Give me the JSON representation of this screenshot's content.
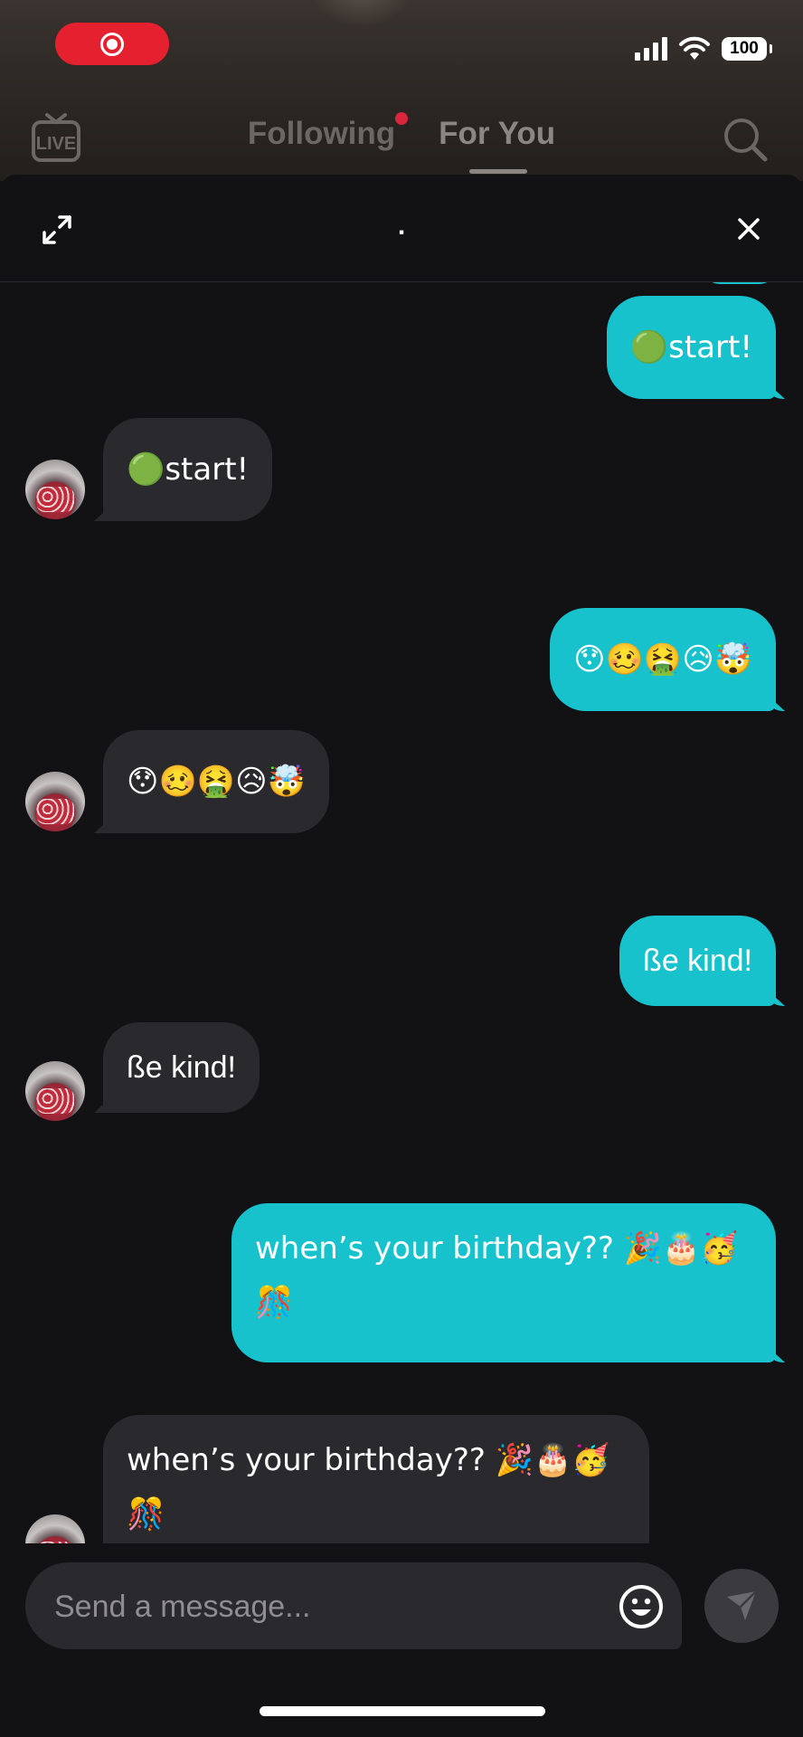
{
  "status_bar": {
    "battery": "100",
    "icons": [
      "screen-record-icon",
      "signal-icon",
      "wifi-icon",
      "battery-icon"
    ]
  },
  "nav": {
    "live_label": "LIVE",
    "tabs": [
      {
        "label": "Following",
        "has_notification": true
      },
      {
        "label": "For You",
        "active": true
      }
    ]
  },
  "chat": {
    "title": ".",
    "messages": [
      {
        "from": "me",
        "text": "🟢start!"
      },
      {
        "from": "them",
        "text": "🟢start!"
      },
      {
        "from": "me",
        "text": "😯🥴🤮😥🤯"
      },
      {
        "from": "them",
        "text": "😯🥴🤮😥🤯"
      },
      {
        "from": "me",
        "text": "ße kind!"
      },
      {
        "from": "them",
        "text": "ße kind!"
      },
      {
        "from": "me",
        "text": "when’s your birthday?? 🎉🎂🥳🎊"
      },
      {
        "from": "them",
        "text": "when’s your birthday?? 🎉🎂🥳🎊"
      }
    ]
  },
  "composer": {
    "placeholder": "Send a message..."
  },
  "colors": {
    "outgoing_bubble": "#17c2cc",
    "incoming_bubble": "#2a292e",
    "background": "#121114",
    "record_pill": "#e5202f"
  }
}
